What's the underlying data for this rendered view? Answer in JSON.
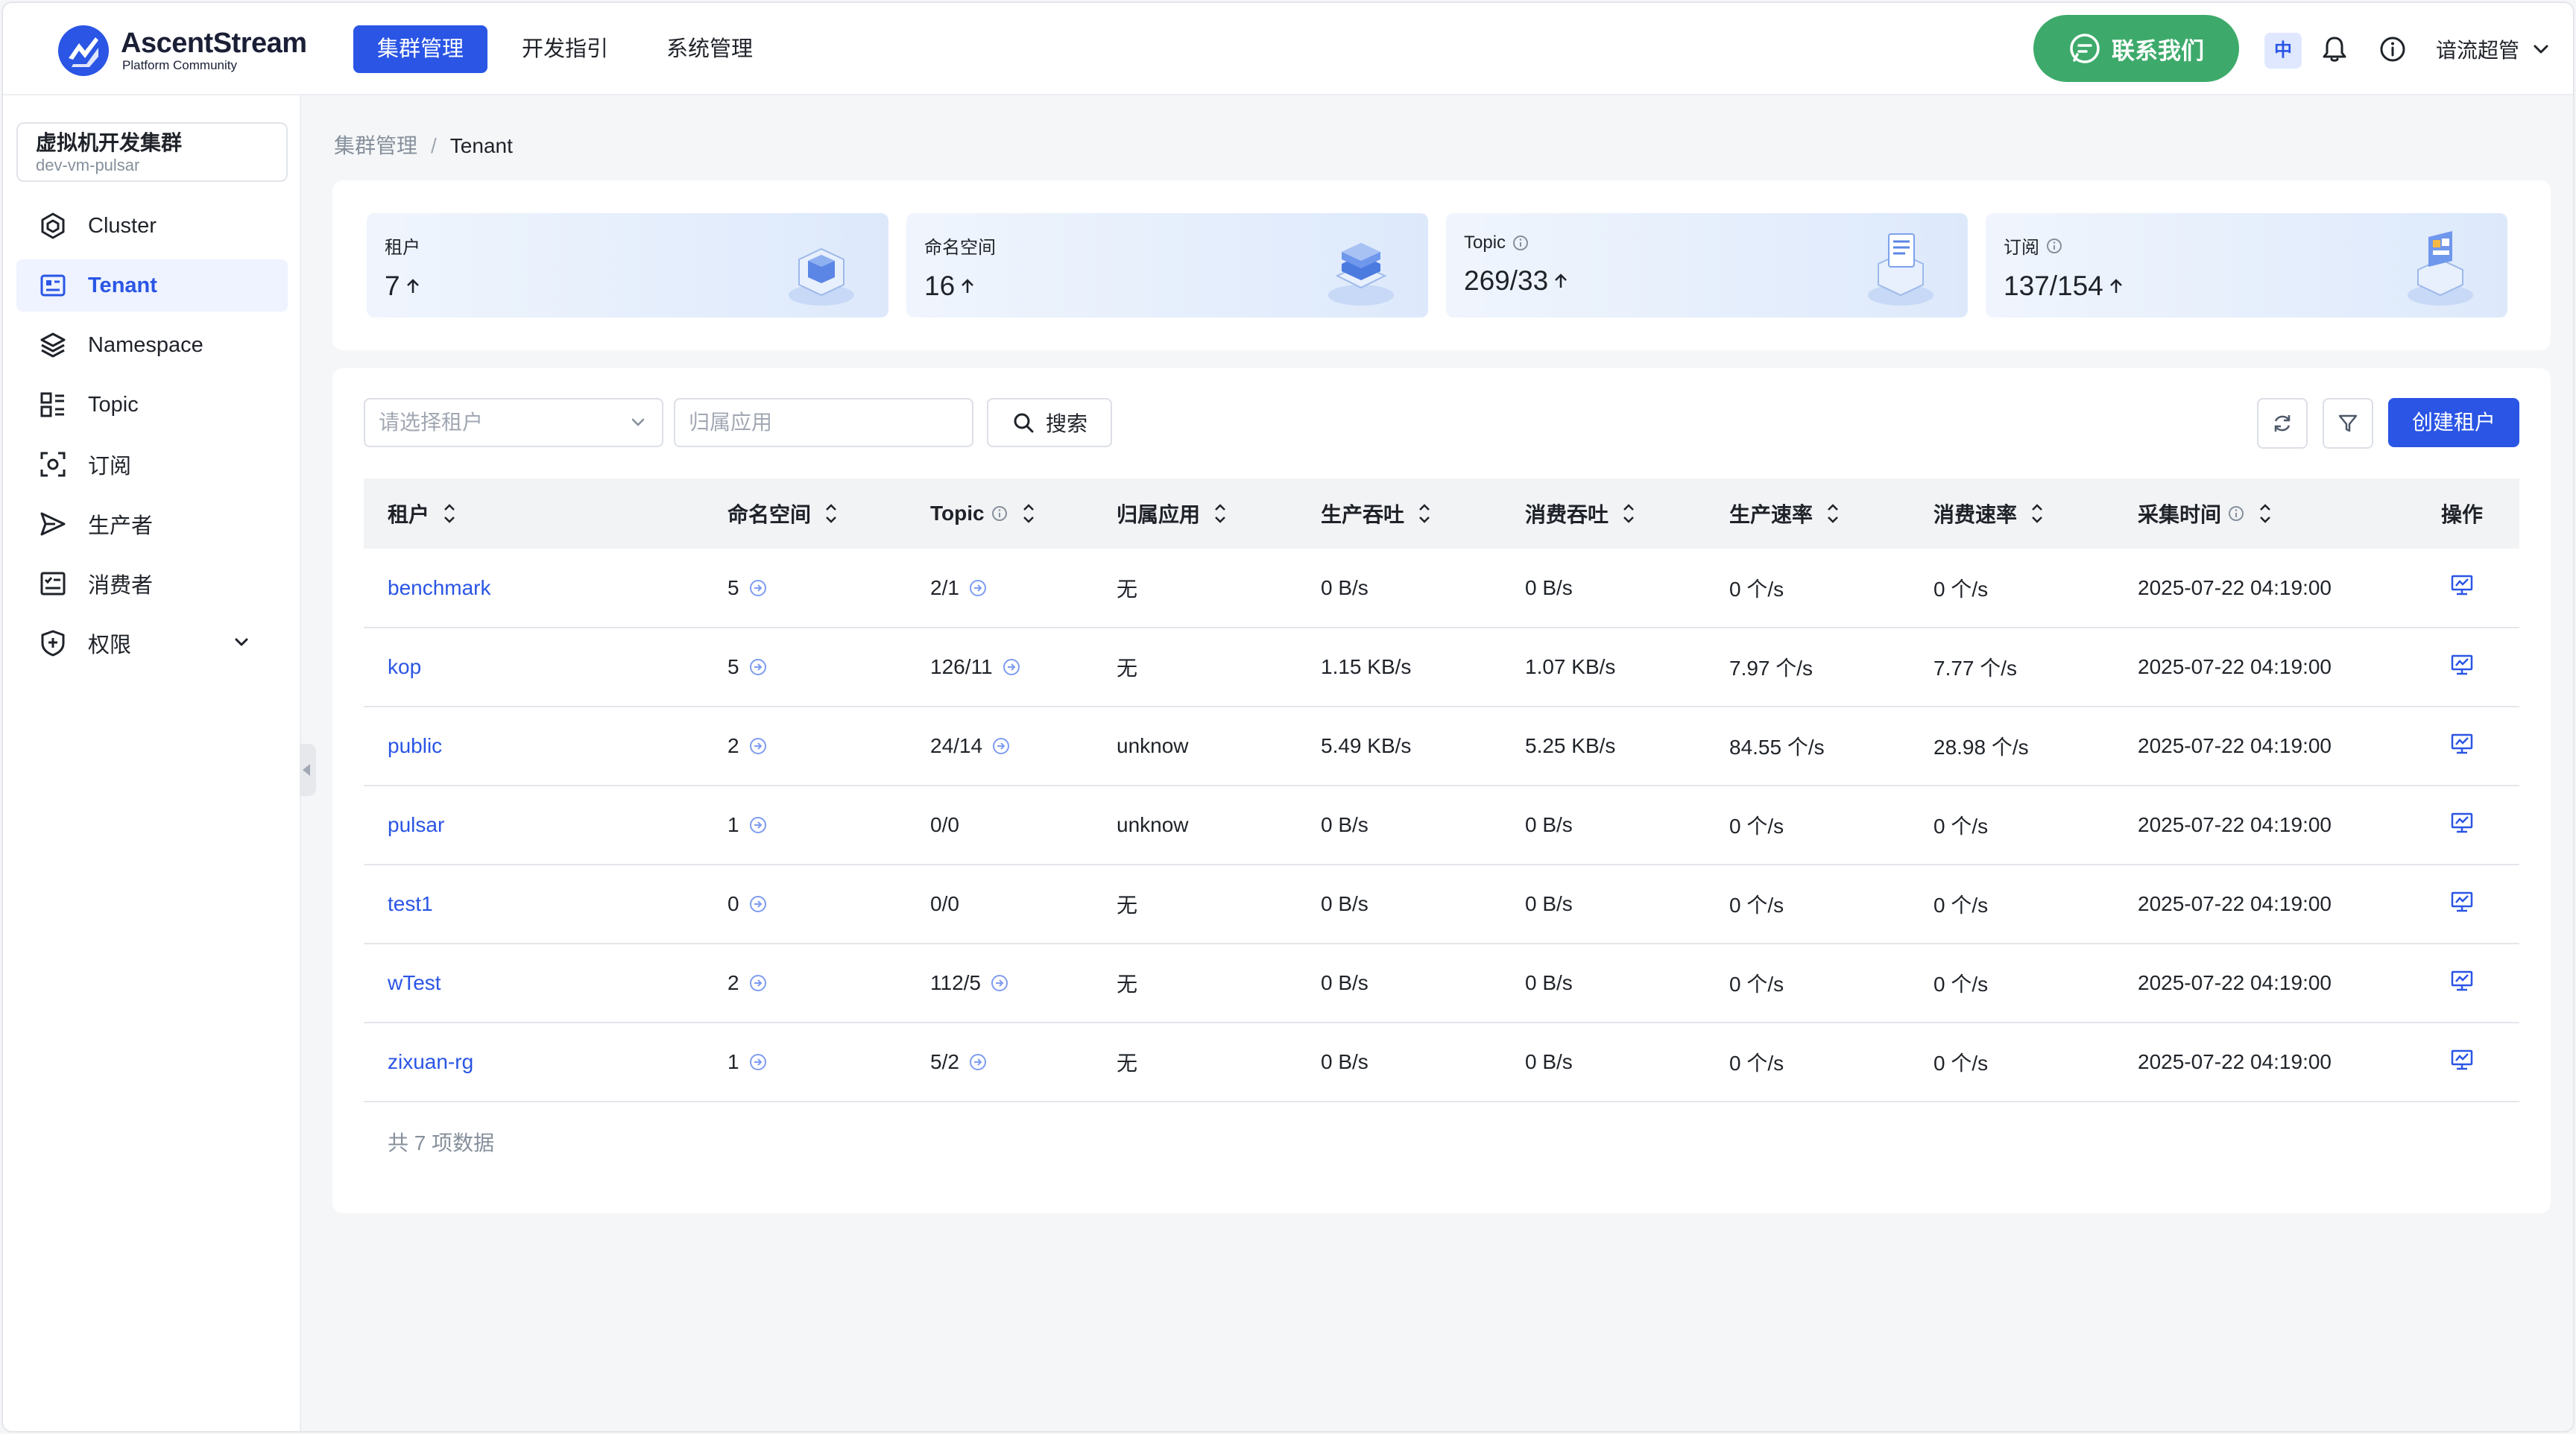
{
  "header": {
    "brand_name": "AscentStream",
    "brand_sub": "Platform Community",
    "nav": [
      "集群管理",
      "开发指引",
      "系统管理"
    ],
    "contact_label": "联系我们",
    "lang_badge": "中",
    "user_name": "谙流超管",
    "accent_color": "#2a55e5",
    "contact_color": "#3daa6b"
  },
  "sidebar": {
    "cluster_name": "虚拟机开发集群",
    "cluster_id": "dev-vm-pulsar",
    "items": [
      {
        "label": "Cluster",
        "icon": "cluster-icon"
      },
      {
        "label": "Tenant",
        "icon": "tenant-icon",
        "active": true
      },
      {
        "label": "Namespace",
        "icon": "layers-icon"
      },
      {
        "label": "Topic",
        "icon": "topic-icon"
      },
      {
        "label": "订阅",
        "icon": "subscription-icon"
      },
      {
        "label": "生产者",
        "icon": "send-icon"
      },
      {
        "label": "消费者",
        "icon": "consumer-icon"
      },
      {
        "label": "权限",
        "icon": "shield-icon"
      }
    ]
  },
  "breadcrumb": {
    "parent": "集群管理",
    "separator": "/",
    "current": "Tenant"
  },
  "stats": [
    {
      "label": "租户",
      "value": "7",
      "info": false
    },
    {
      "label": "命名空间",
      "value": "16",
      "info": false
    },
    {
      "label": "Topic",
      "value": "269/33",
      "info": true
    },
    {
      "label": "订阅",
      "value": "137/154",
      "info": true
    }
  ],
  "toolbar": {
    "tenant_select_placeholder": "请选择租户",
    "app_input_placeholder": "归属应用",
    "search_label": "搜索",
    "create_label": "创建租户"
  },
  "table": {
    "headers": [
      "租户",
      "命名空间",
      "Topic",
      "归属应用",
      "生产吞吐",
      "消费吞吐",
      "生产速率",
      "消费速率",
      "采集时间",
      "操作"
    ],
    "rows": [
      {
        "tenant": "benchmark",
        "namespaces": "5",
        "topic": "2/1",
        "app": "无",
        "prod_tp": "0 B/s",
        "cons_tp": "0 B/s",
        "prod_rate": "0 个/s",
        "cons_rate": "0 个/s",
        "time": "2025-07-22 04:19:00"
      },
      {
        "tenant": "kop",
        "namespaces": "5",
        "topic": "126/11",
        "app": "无",
        "prod_tp": "1.15 KB/s",
        "cons_tp": "1.07 KB/s",
        "prod_rate": "7.97 个/s",
        "cons_rate": "7.77 个/s",
        "time": "2025-07-22 04:19:00"
      },
      {
        "tenant": "public",
        "namespaces": "2",
        "topic": "24/14",
        "app": "unknow",
        "prod_tp": "5.49 KB/s",
        "cons_tp": "5.25 KB/s",
        "prod_rate": "84.55 个/s",
        "cons_rate": "28.98 个/s",
        "time": "2025-07-22 04:19:00"
      },
      {
        "tenant": "pulsar",
        "namespaces": "1",
        "topic": "0/0",
        "app": "unknow",
        "prod_tp": "0 B/s",
        "cons_tp": "0 B/s",
        "prod_rate": "0 个/s",
        "cons_rate": "0 个/s",
        "time": "2025-07-22 04:19:00"
      },
      {
        "tenant": "test1",
        "namespaces": "0",
        "topic": "0/0",
        "app": "无",
        "prod_tp": "0 B/s",
        "cons_tp": "0 B/s",
        "prod_rate": "0 个/s",
        "cons_rate": "0 个/s",
        "time": "2025-07-22 04:19:00"
      },
      {
        "tenant": "wTest",
        "namespaces": "2",
        "topic": "112/5",
        "app": "无",
        "prod_tp": "0 B/s",
        "cons_tp": "0 B/s",
        "prod_rate": "0 个/s",
        "cons_rate": "0 个/s",
        "time": "2025-07-22 04:19:00"
      },
      {
        "tenant": "zixuan-rg",
        "namespaces": "1",
        "topic": "5/2",
        "app": "无",
        "prod_tp": "0 B/s",
        "cons_tp": "0 B/s",
        "prod_rate": "0 个/s",
        "cons_rate": "0 个/s",
        "time": "2025-07-22 04:19:00"
      }
    ],
    "total_text": "共 7 项数据"
  }
}
